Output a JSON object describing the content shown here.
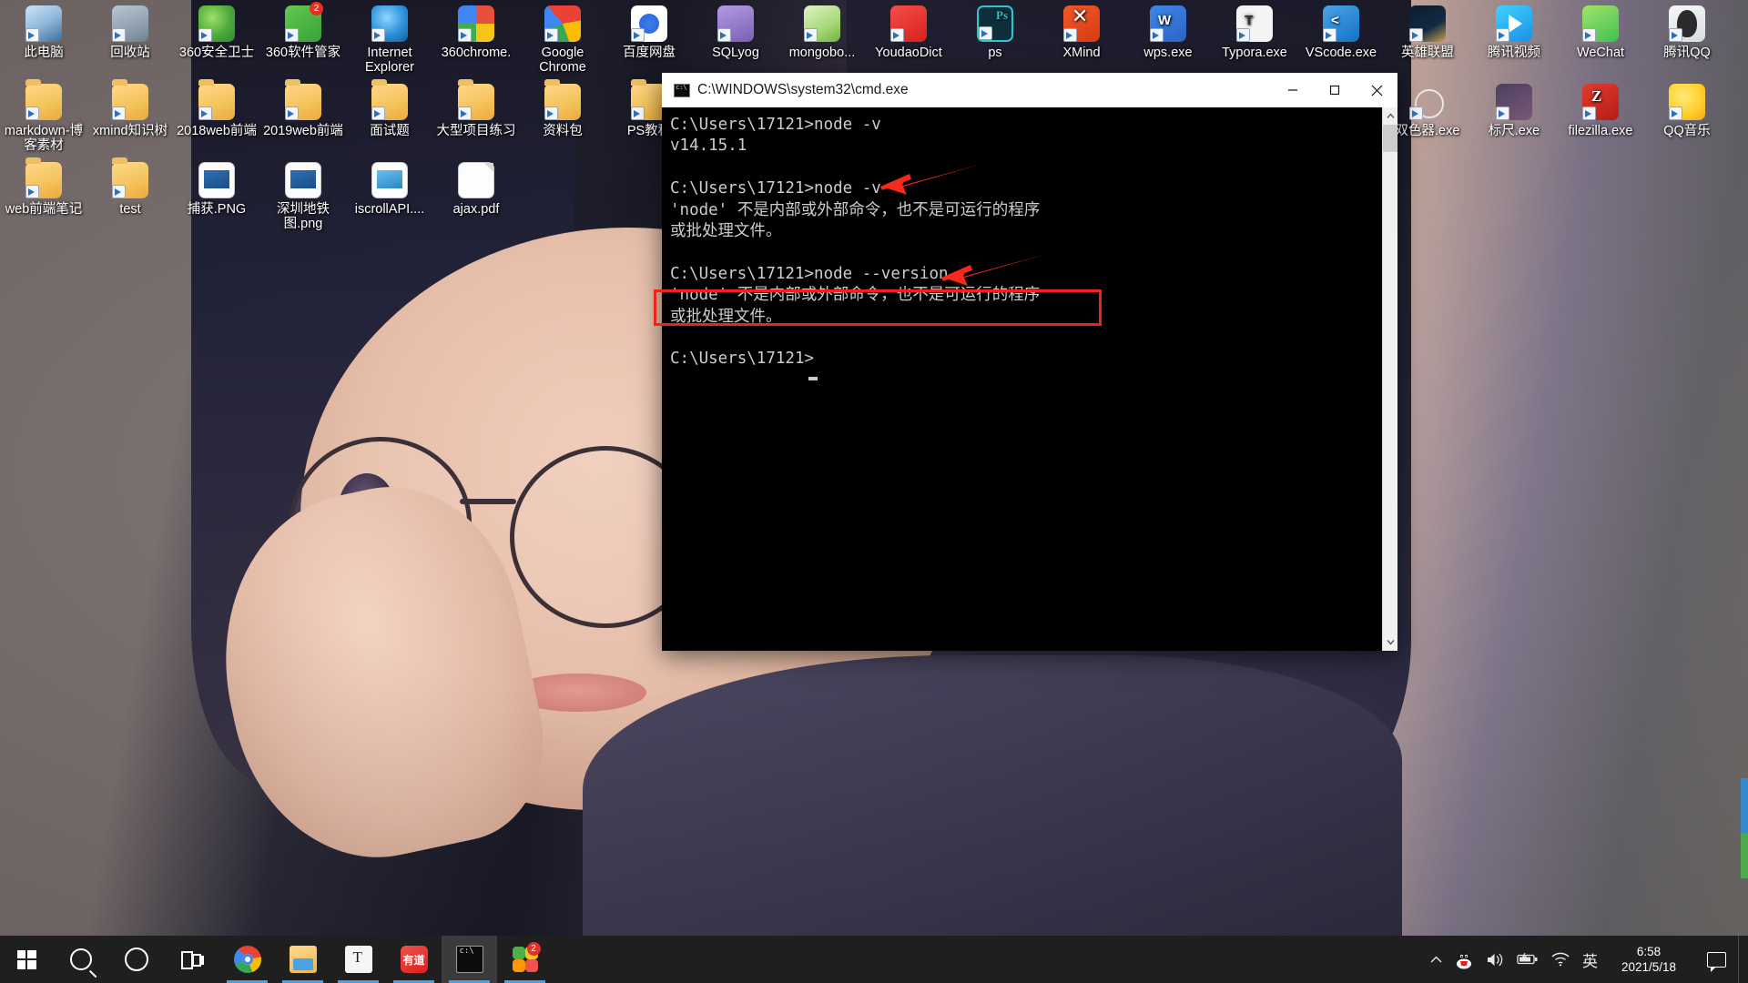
{
  "desktop": {
    "icons_row1": [
      {
        "label": "此电脑",
        "icon": "this-pc-icon"
      },
      {
        "label": "回收站",
        "icon": "recycle-bin-icon"
      },
      {
        "label": "360安全卫士",
        "icon": "360-security-icon"
      },
      {
        "label": "360软件管家",
        "icon": "360-software-manager-icon",
        "badge": "2"
      },
      {
        "label": "Internet Explorer",
        "icon": "internet-explorer-icon"
      },
      {
        "label": "360chrome.",
        "icon": "360-chrome-icon"
      },
      {
        "label": "Google Chrome",
        "icon": "google-chrome-icon"
      },
      {
        "label": "百度网盘",
        "icon": "baidu-netdisk-icon"
      },
      {
        "label": "SQLyog",
        "icon": "sqlyog-icon"
      },
      {
        "label": "mongobo...",
        "icon": "mongodb-compass-icon"
      },
      {
        "label": "YoudaoDict",
        "icon": "youdao-dict-icon"
      },
      {
        "label": "ps",
        "icon": "photoshop-icon"
      },
      {
        "label": "XMind",
        "icon": "xmind-icon"
      },
      {
        "label": "wps.exe",
        "icon": "wps-icon"
      },
      {
        "label": "Typora.exe",
        "icon": "typora-icon"
      },
      {
        "label": "VScode.exe",
        "icon": "vscode-icon"
      },
      {
        "label": "英雄联盟",
        "icon": "league-of-legends-icon"
      },
      {
        "label": "腾讯视频",
        "icon": "tencent-video-icon"
      },
      {
        "label": "WeChat",
        "icon": "wechat-icon"
      },
      {
        "label": "腾讯QQ",
        "icon": "tencent-qq-icon"
      }
    ],
    "icons_row2": [
      {
        "label": "markdown-博客素材",
        "icon": "folder-icon"
      },
      {
        "label": "xmind知识树",
        "icon": "folder-icon"
      },
      {
        "label": "2018web前端",
        "icon": "folder-icon"
      },
      {
        "label": "2019web前端",
        "icon": "folder-icon"
      },
      {
        "label": "面试题",
        "icon": "folder-icon"
      },
      {
        "label": "大型项目练习",
        "icon": "folder-icon"
      },
      {
        "label": "资料包",
        "icon": "folder-icon"
      },
      {
        "label": "PS教程",
        "icon": "folder-icon"
      },
      {
        "label": "双色器.exe",
        "icon": "color-picker-icon"
      },
      {
        "label": "标尺.exe",
        "icon": "ruler-icon"
      },
      {
        "label": "filezilla.exe",
        "icon": "filezilla-icon"
      },
      {
        "label": "QQ音乐",
        "icon": "qq-music-icon"
      }
    ],
    "icons_row3": [
      {
        "label": "web前端笔记",
        "icon": "folder-icon"
      },
      {
        "label": "test",
        "icon": "folder-icon"
      },
      {
        "label": "捕获.PNG",
        "icon": "image-file-icon"
      },
      {
        "label": "深圳地铁图.png",
        "icon": "image-file-icon"
      },
      {
        "label": "iscrollAPI....",
        "icon": "image-file-icon"
      },
      {
        "label": "ajax.pdf",
        "icon": "document-file-icon"
      }
    ]
  },
  "cmd_window": {
    "title": "C:\\WINDOWS\\system32\\cmd.exe",
    "minimize_label": "—",
    "maximize_label": "☐",
    "close_label": "✕",
    "console_text": "C:\\Users\\17121>node -v\nv14.15.1\n\nC:\\Users\\17121>node -v\n'node' 不是内部或外部命令，也不是可运行的程序\n或批处理文件。\n\nC:\\Users\\17121>node --version\n'node' 不是内部或外部命令，也不是可运行的程序\n或批处理文件。\n\nC:\\Users\\17121>",
    "commands": [
      {
        "prompt": "C:\\Users\\17121>",
        "command": "node -v",
        "output": [
          "v14.15.1"
        ]
      },
      {
        "prompt": "C:\\Users\\17121>",
        "command": "node -v",
        "output": [
          "'node' 不是内部或外部命令，也不是可运行的程序",
          "或批处理文件。"
        ]
      },
      {
        "prompt": "C:\\Users\\17121>",
        "command": "node --version",
        "output": [
          "'node' 不是内部或外部命令，也不是可运行的程序",
          "或批处理文件。"
        ]
      },
      {
        "prompt": "C:\\Users\\17121>",
        "command": "",
        "output": []
      }
    ],
    "annotations": {
      "highlight_color": "#ef2418",
      "arrow_color": "#f5291c",
      "arrow_count": 2,
      "rect_target": "'node' 不是内部或外部命令，也不是可运行的程序"
    }
  },
  "taskbar": {
    "start_label": "start-button",
    "items": [
      {
        "name": "search",
        "label": "搜索"
      },
      {
        "name": "cortana",
        "label": "Cortana"
      },
      {
        "name": "task-view",
        "label": "任务视图"
      },
      {
        "name": "chrome",
        "label": "Google Chrome"
      },
      {
        "name": "file-explorer",
        "label": "文件资源管理器"
      },
      {
        "name": "typora",
        "label": "Typora"
      },
      {
        "name": "youdao",
        "label": "有道"
      },
      {
        "name": "cmd",
        "label": "命令提示符"
      },
      {
        "name": "apps",
        "label": "应用"
      }
    ],
    "apps_badge": "2",
    "tray": {
      "chevron": "∧",
      "items": [
        {
          "name": "qq",
          "label": "QQ"
        },
        {
          "name": "volume",
          "label": "音量"
        },
        {
          "name": "battery",
          "label": "电池"
        },
        {
          "name": "network",
          "label": "网络"
        },
        {
          "name": "ime",
          "label": "英"
        }
      ],
      "clock_time": "6:58",
      "clock_date": "2021/5/18",
      "action_center": "通知中心"
    }
  }
}
